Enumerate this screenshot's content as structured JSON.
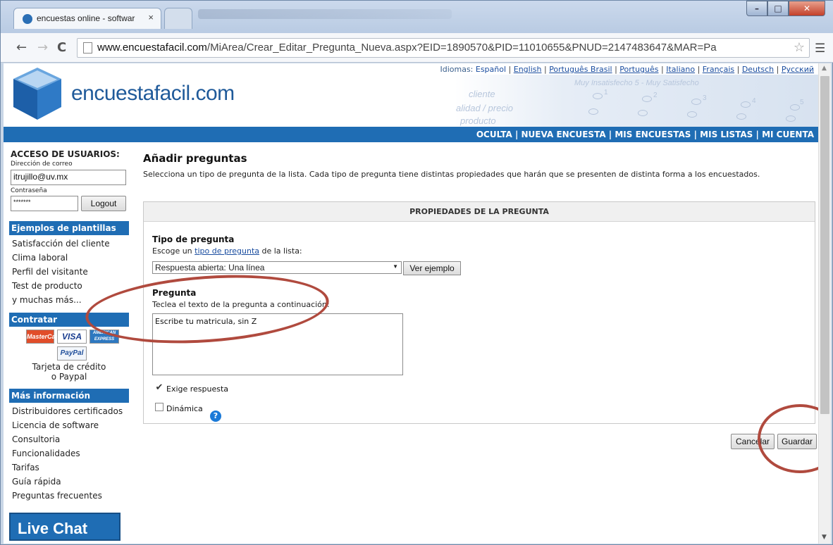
{
  "browser": {
    "tab_title": "encuestas online - softwar",
    "tab_close": "×",
    "url_domain": "www.encuestafacil.com",
    "url_path": "/MiArea/Crear_Editar_Pregunta_Nueva.aspx?EID=1890570&PID=11010655&PNUD=2147483647&MAR=Pa",
    "icons": [
      "back-icon",
      "forward-icon",
      "reload-icon",
      "page-icon",
      "star-icon",
      "menu-icon",
      "minimize-icon",
      "maximize-icon",
      "close-icon"
    ]
  },
  "header": {
    "logo_text": "encuestafacil.com",
    "languages_label": "Idiomas:",
    "current_language": "Español",
    "languages": [
      "English",
      "Português Brasil",
      "Português",
      "Italiano",
      "Français",
      "Deutsch",
      "Русский"
    ],
    "art_rows": [
      "cliente",
      "alidad / precio",
      "producto"
    ],
    "art_header": "Muy Insatisfecho 5 - Muy Satisfecho",
    "art_numbers": [
      "1",
      "2",
      "3",
      "4",
      "5"
    ]
  },
  "nav": {
    "links": [
      "OCULTA",
      "NUEVA ENCUESTA",
      "MIS ENCUESTAS",
      "MIS LISTAS",
      "MI CUENTA"
    ]
  },
  "sidebar": {
    "login_title": "ACCESO DE USUARIOS:",
    "email_label": "Dirección de correo",
    "email_value": "itrujillo@uv.mx",
    "password_label": "Contraseña",
    "password_value": "*******",
    "logout_label": "Logout",
    "templates_title": "Ejemplos de plantillas",
    "templates": [
      "Satisfacción del cliente",
      "Clima laboral",
      "Perfil del visitante",
      "Test de producto",
      "y muchas más..."
    ],
    "contract_title": "Contratar",
    "cards": [
      "MasterCard",
      "VISA",
      "AMERICAN EXPRESS",
      "PayPal"
    ],
    "payment_text_1": "Tarjeta de crédito",
    "payment_text_2": "o Paypal",
    "more_title": "Más información",
    "more_links": [
      "Distribuidores certificados",
      "Licencia de software",
      "Consultoria",
      "Funcionalidades",
      "Tarifas",
      "Guía rápida",
      "Preguntas frecuentes"
    ],
    "live_chat": "Live Chat"
  },
  "main": {
    "title": "Añadir preguntas",
    "description": "Selecciona un tipo de pregunta de la lista. Cada tipo de pregunta tiene distintas propiedades que harán que se presenten de distinta forma a los encuestados.",
    "panel_title": "PROPIEDADES DE LA PREGUNTA",
    "type_label": "Tipo de pregunta",
    "type_hint_pre": "Escoge un",
    "type_hint_link": "tipo de pregunta",
    "type_hint_post": "de la lista:",
    "type_selected": "Respuesta abierta: Una línea",
    "example_button": "Ver ejemplo",
    "question_label": "Pregunta",
    "question_hint": "Teclea el texto de la pregunta a continuación:",
    "question_value": "Escribe tu matricula, sin Z",
    "required_label": "Exige respuesta",
    "required_checked": true,
    "dynamic_label": "Dinámica",
    "dynamic_checked": false,
    "help_glyph": "?",
    "cancel_label": "Cancelar",
    "save_label": "Guardar"
  },
  "annotations": {
    "color": "#b04a3e"
  }
}
